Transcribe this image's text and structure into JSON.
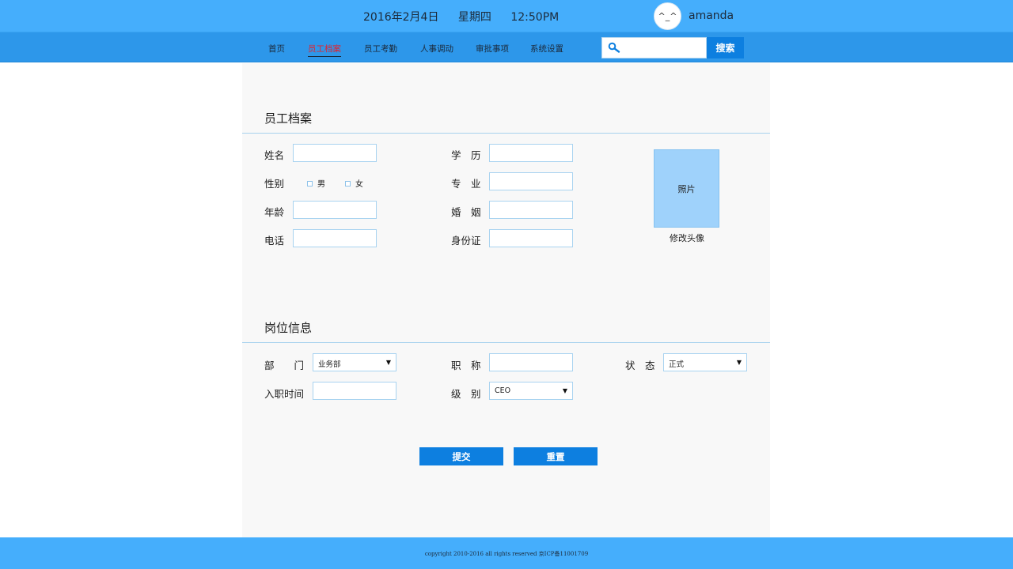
{
  "header": {
    "date": "2016年2月4日",
    "weekday": "星期四",
    "time": "12:50PM",
    "avatar_glyph": "^_^",
    "username": "amanda"
  },
  "nav": {
    "items": [
      {
        "label": "首页",
        "active": false
      },
      {
        "label": "员工档案",
        "active": true
      },
      {
        "label": "员工考勤",
        "active": false
      },
      {
        "label": "人事调动",
        "active": false
      },
      {
        "label": "审批事项",
        "active": false
      },
      {
        "label": "系统设置",
        "active": false
      }
    ],
    "search_placeholder": "",
    "search_value": "",
    "search_button": "搜索"
  },
  "profile": {
    "title": "员工档案",
    "name_label": "姓名",
    "gender_label": "性别",
    "gender_male": "男",
    "gender_female": "女",
    "age_label": "年龄",
    "phone_label": "电话",
    "education_label": "学　历",
    "major_label": "专　业",
    "marriage_label": "婚　姻",
    "id_label": "身份证",
    "photo_label": "照片",
    "change_avatar": "修改头像"
  },
  "position": {
    "title": "岗位信息",
    "department_label": "部　　门",
    "department_value": "业务部",
    "hire_date_label": "入职时间",
    "job_title_label": "职　称",
    "level_label": "级　别",
    "level_value": "CEO",
    "status_label": "状　态",
    "status_value": "正式"
  },
  "actions": {
    "submit": "提交",
    "reset": "重置"
  },
  "footer": {
    "copyright": "copyright 2010-2016   all rights reserved 京ICP备11001709"
  },
  "colors": {
    "topbar": "#45aefc",
    "navbar": "#2d97ea",
    "active_nav": "#e02430",
    "button": "#0d7fe0",
    "photo": "#9fd2fb"
  }
}
